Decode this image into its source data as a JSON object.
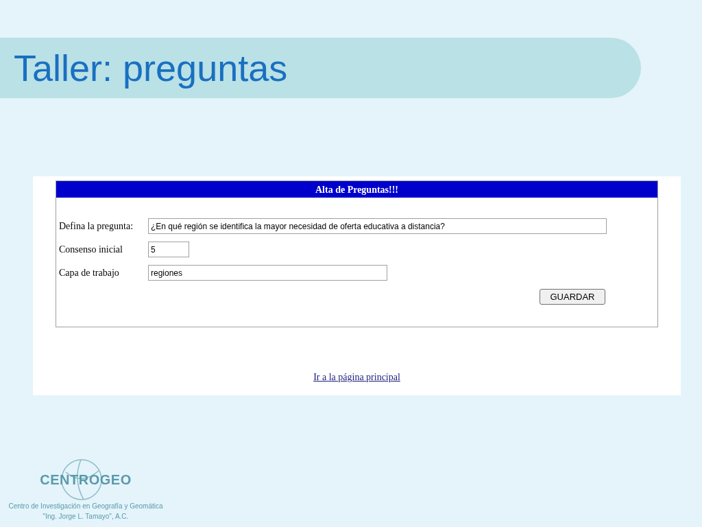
{
  "slide_title": "Taller: preguntas",
  "form": {
    "header": "Alta de Preguntas!!!",
    "fields": [
      {
        "label": "Defina la pregunta:",
        "value": "¿En qué región se identifica la mayor necesidad de oferta educativa a distancia?",
        "kind": "wide"
      },
      {
        "label": "Consenso inicial",
        "value": "5",
        "kind": "small"
      },
      {
        "label": "Capa de trabajo",
        "value": "regiones",
        "kind": "medium"
      }
    ],
    "button": "GUARDAR"
  },
  "link": "Ir a la página principal",
  "footer": {
    "logo_text": "CENTROGEO",
    "org_line_1": "Centro de Investigación en Geografía y Geomática",
    "org_line_2": "\"Ing. Jorge L. Tamayo\", A.C."
  }
}
